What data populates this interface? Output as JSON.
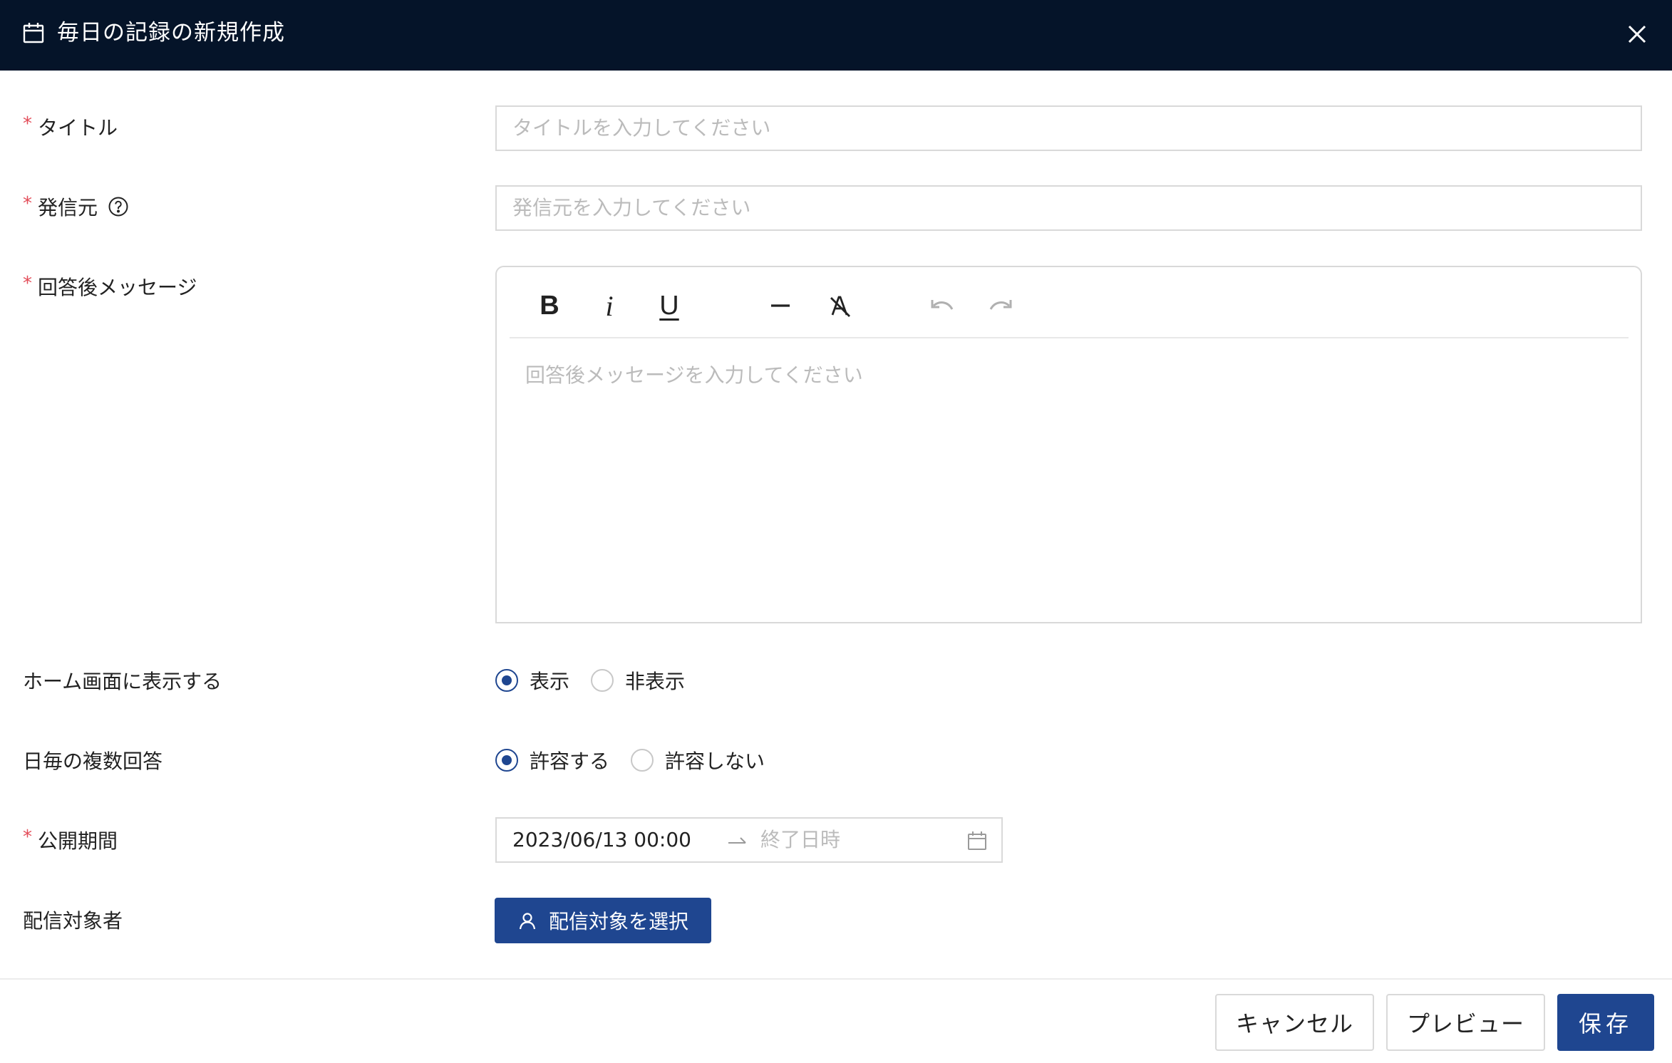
{
  "header": {
    "title": "毎日の記録の新規作成",
    "icon": "calendar-icon",
    "close_icon": "close-icon"
  },
  "form": {
    "title": {
      "label": "タイトル",
      "required": true,
      "placeholder": "タイトルを入力してください",
      "value": ""
    },
    "sender": {
      "label": "発信元",
      "required": true,
      "help_icon": "question-circle-icon",
      "placeholder": "発信元を入力してください",
      "value": ""
    },
    "after_message": {
      "label": "回答後メッセージ",
      "required": true,
      "toolbar": {
        "bold": "B",
        "italic": "i",
        "underline": "U",
        "hr_icon": "horizontal-rule-icon",
        "clear_icon": "clear-format-icon",
        "undo_icon": "undo-icon",
        "redo_icon": "redo-icon"
      },
      "placeholder": "回答後メッセージを入力してください"
    },
    "home_display": {
      "label": "ホーム画面に表示する",
      "options": [
        "表示",
        "非表示"
      ],
      "selected": "表示"
    },
    "multi_answer": {
      "label": "日毎の複数回答",
      "options": [
        "許容する",
        "許容しない"
      ],
      "selected": "許容する"
    },
    "period": {
      "label": "公開期間",
      "required": true,
      "start": "2023/06/13 00:00",
      "end_placeholder": "終了日時",
      "arrow_icon": "arrow-right-icon",
      "calendar_icon": "calendar-icon"
    },
    "audience": {
      "label": "配信対象者",
      "button_label": "配信対象を選択",
      "button_icon": "user-icon"
    }
  },
  "footer": {
    "cancel": "キャンセル",
    "preview": "プレビュー",
    "save": "保存"
  },
  "colors": {
    "header_bg": "#051429",
    "primary": "#1f4690",
    "required": "#e34d59",
    "placeholder": "#bbbbbb",
    "border": "#d9d9d9"
  }
}
